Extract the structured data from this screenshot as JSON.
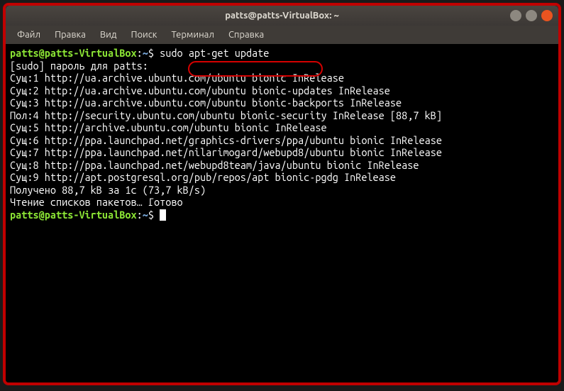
{
  "titlebar": {
    "title": "patts@patts-VirtualBox: ~"
  },
  "menubar": {
    "file": "Файл",
    "edit": "Правка",
    "view": "Вид",
    "search": "Поиск",
    "terminal": "Терминал",
    "help": "Справка"
  },
  "prompt": {
    "user_host": "patts@patts-VirtualBox",
    "colon": ":",
    "path": "~",
    "dollar": "$"
  },
  "command1": "sudo apt-get update",
  "output": {
    "l0": "[sudo] пароль для patts:",
    "l1": "Сущ:1 http://ua.archive.ubuntu.com/ubuntu bionic InRelease",
    "l2": "Сущ:2 http://ua.archive.ubuntu.com/ubuntu bionic-updates InRelease",
    "l3": "Сущ:3 http://ua.archive.ubuntu.com/ubuntu bionic-backports InRelease",
    "l4": "Пол:4 http://security.ubuntu.com/ubuntu bionic-security InRelease [88,7 kB]",
    "l5": "Сущ:5 http://archive.ubuntu.com/ubuntu bionic InRelease",
    "l6": "Сущ:6 http://ppa.launchpad.net/graphics-drivers/ppa/ubuntu bionic InRelease",
    "l7": "Сущ:7 http://ppa.launchpad.net/nilarimogard/webupd8/ubuntu bionic InRelease",
    "l8": "Сущ:8 http://ppa.launchpad.net/webupd8team/java/ubuntu bionic InRelease",
    "l9": "Сущ:9 http://apt.postgresql.org/pub/repos/apt bionic-pgdg InRelease",
    "l10": "Получено 88,7 kB за 1с (73,7 kB/s)",
    "l11": "Чтение списков пакетов… Готово"
  }
}
